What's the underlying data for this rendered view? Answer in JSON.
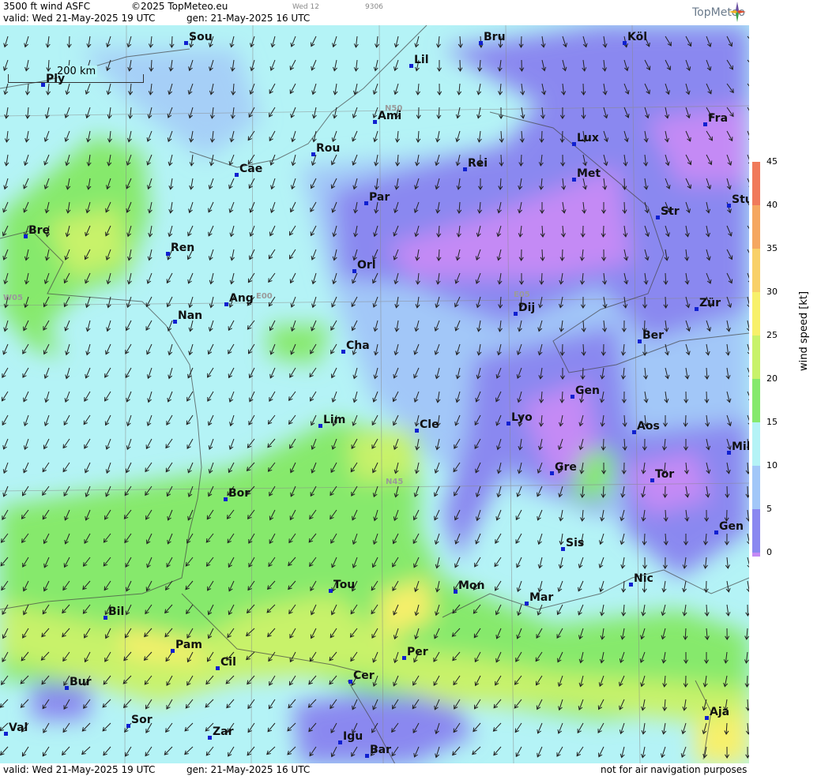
{
  "header": {
    "title": "3500 ft wind ASFC",
    "copyright": "©2025 TopMeteo.eu",
    "day_code": "Wed 12",
    "code": "9306",
    "valid": "valid:  Wed  21-May-2025  19 UTC",
    "gen": "gen: 21-May-2025 16 UTC",
    "logo": "TopMeteo"
  },
  "footer": {
    "valid": "valid:  Wed  21-May-2025  19 UTC",
    "gen": "gen: 21-May-2025 16 UTC",
    "note": "not for air navigation purposes"
  },
  "scale": {
    "label": "200 km"
  },
  "grid_labels": {
    "n50": "N50",
    "n45": "N45",
    "w05": "W05",
    "e00": "E00",
    "e05": "E05"
  },
  "legend": {
    "title": "wind  speed  [kt]",
    "ticks": [
      "45",
      "40",
      "35",
      "30",
      "25",
      "20",
      "15",
      "10",
      "5",
      "0"
    ],
    "colors": [
      "#f07a5a",
      "#f5a760",
      "#f8d068",
      "#f7f06a",
      "#c8f26a",
      "#86e96c",
      "#b4f3f6",
      "#a2c7f8",
      "#8a88f0",
      "#c48af5"
    ]
  },
  "cities": [
    {
      "name": "Sou"
    },
    {
      "name": "Bru"
    },
    {
      "name": "Köl"
    },
    {
      "name": "Ply"
    },
    {
      "name": "Lil"
    },
    {
      "name": "Ami"
    },
    {
      "name": "Fra"
    },
    {
      "name": "Rou"
    },
    {
      "name": "Lux"
    },
    {
      "name": "Cae"
    },
    {
      "name": "Rei"
    },
    {
      "name": "Met"
    },
    {
      "name": "Par"
    },
    {
      "name": "Stu"
    },
    {
      "name": "Bre"
    },
    {
      "name": "Str"
    },
    {
      "name": "Ren"
    },
    {
      "name": "Orl"
    },
    {
      "name": "Ang"
    },
    {
      "name": "Dij"
    },
    {
      "name": "Zür"
    },
    {
      "name": "Nan"
    },
    {
      "name": "Cha"
    },
    {
      "name": "Ber"
    },
    {
      "name": "Gen"
    },
    {
      "name": "Lim"
    },
    {
      "name": "Cle"
    },
    {
      "name": "Lyo"
    },
    {
      "name": "Aos"
    },
    {
      "name": "Mil"
    },
    {
      "name": "Gre"
    },
    {
      "name": "Tor"
    },
    {
      "name": "Bor"
    },
    {
      "name": "Gen"
    },
    {
      "name": "Sis"
    },
    {
      "name": "Nic"
    },
    {
      "name": "Tou"
    },
    {
      "name": "Mon"
    },
    {
      "name": "Mar"
    },
    {
      "name": "Bil"
    },
    {
      "name": "Pam"
    },
    {
      "name": "Per"
    },
    {
      "name": "Cil"
    },
    {
      "name": "Cer"
    },
    {
      "name": "Bur"
    },
    {
      "name": "Aja"
    },
    {
      "name": "Sor"
    },
    {
      "name": "Val"
    },
    {
      "name": "Zar"
    },
    {
      "name": "Igu"
    },
    {
      "name": "Bar"
    }
  ]
}
